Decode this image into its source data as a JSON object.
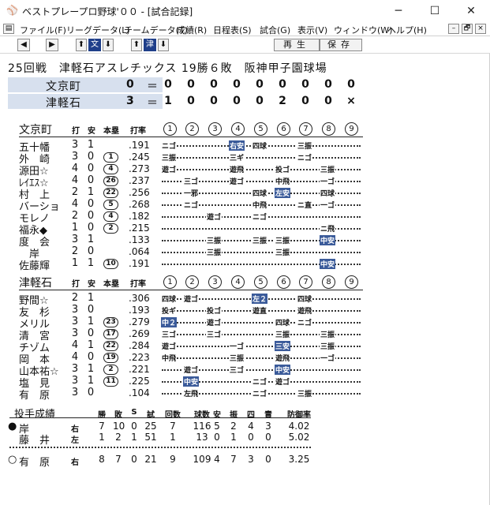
{
  "window": {
    "title": "ベストプレープロ野球'００ - [試合記録]",
    "app_icon": "baseball-cap-icon",
    "controls": [
      "─",
      "☐",
      "✕"
    ]
  },
  "menu": {
    "items": [
      "ファイル(F)",
      "リーグデータ(L)",
      "チームデータ(T)",
      "成績(R)",
      "日程表(S)",
      "試合(G)",
      "表示(V)",
      "ウィンドウ(W)",
      "ヘルプ(H)"
    ],
    "mdi_controls": [
      "–",
      "🗗",
      "×"
    ]
  },
  "toolbar": {
    "prev": "◀",
    "next": "▶",
    "home_up": "⬆",
    "home_label": "文",
    "home_down": "⬇",
    "away_up": "⬆",
    "away_label": "津",
    "away_down": "⬇",
    "replay": "再生",
    "save": "保存"
  },
  "game": {
    "info": "25回戦　津軽石アスレチックス 19勝６敗　阪神甲子園球場"
  },
  "linescore": [
    {
      "team": "文京町",
      "runs": "0",
      "innings": [
        "0",
        "0",
        "0",
        "0",
        "0",
        "0",
        "0",
        "0",
        "0"
      ]
    },
    {
      "team": "津軽石",
      "runs": "3",
      "innings": [
        "1",
        "0",
        "0",
        "0",
        "0",
        "2",
        "0",
        "0",
        "×"
      ]
    }
  ],
  "box_headers": {
    "ab": "打",
    "h": "安",
    "hr": "本塁",
    "avg": "打率",
    "innings": [
      "1",
      "2",
      "3",
      "4",
      "5",
      "6",
      "7",
      "8",
      "9"
    ]
  },
  "teams": [
    {
      "name": "文京町",
      "players": [
        {
          "name": "五十幡",
          "ab": "3",
          "h": "1",
          "hr": "",
          "avg": ".191",
          "results": [
            [
              "1",
              "ニゴ",
              0
            ],
            [
              "4",
              "右安",
              1
            ],
            [
              "5",
              "四球",
              0
            ],
            [
              "7",
              "三振",
              0
            ]
          ]
        },
        {
          "name": "外　崎",
          "ab": "3",
          "h": "0",
          "hr": "1",
          "avg": ".245",
          "results": [
            [
              "1",
              "三振",
              0
            ],
            [
              "4",
              "三ギ",
              0
            ],
            [
              "7",
              "ニゴ",
              0
            ]
          ]
        },
        {
          "name": "源田☆",
          "ab": "4",
          "h": "0",
          "hr": "4",
          "avg": ".273",
          "results": [
            [
              "1",
              "遊ゴ",
              0
            ],
            [
              "4",
              "遊飛",
              0
            ],
            [
              "6",
              "投ゴ",
              0
            ],
            [
              "8",
              "三振",
              0
            ]
          ]
        },
        {
          "name": "ﾚｲｴｽ☆",
          "ab": "4",
          "h": "0",
          "hr": "26",
          "avg": ".237",
          "results": [
            [
              "2",
              "三ゴ",
              0
            ],
            [
              "4",
              "遊ゴ",
              0
            ],
            [
              "6",
              "中飛",
              0
            ],
            [
              "8",
              "一ゴ",
              0
            ]
          ]
        },
        {
          "name": "村　上",
          "ab": "2",
          "h": "1",
          "hr": "22",
          "avg": ".256",
          "results": [
            [
              "2",
              "一邪",
              0
            ],
            [
              "5",
              "四球",
              0
            ],
            [
              "6",
              "左安",
              1
            ],
            [
              "8",
              "四球",
              0
            ]
          ]
        },
        {
          "name": "バーショ",
          "ab": "4",
          "h": "0",
          "hr": "5",
          "avg": ".268",
          "results": [
            [
              "2",
              "ニゴ",
              0
            ],
            [
              "5",
              "中飛",
              0
            ],
            [
              "7",
              "ニ直",
              0
            ],
            [
              "8",
              "一ゴ",
              0
            ]
          ]
        },
        {
          "name": "モレノ",
          "ab": "2",
          "h": "0",
          "hr": "4",
          "avg": ".182",
          "results": [
            [
              "3",
              "遊ゴ",
              0
            ],
            [
              "5",
              "ニゴ",
              0
            ]
          ]
        },
        {
          "name": "福永◆",
          "ab": "1",
          "h": "0",
          "hr": "2",
          "avg": ".215",
          "results": [
            [
              "8",
              "ニ飛",
              0
            ]
          ]
        },
        {
          "name": "度　会",
          "ab": "3",
          "h": "1",
          "hr": "",
          "avg": ".133",
          "results": [
            [
              "3",
              "三振",
              0
            ],
            [
              "5",
              "三振",
              0
            ],
            [
              "6",
              "三振",
              0
            ],
            [
              "8",
              "中安",
              1
            ]
          ]
        },
        {
          "name": "　岸",
          "ab": "2",
          "h": "0",
          "hr": "",
          "avg": ".064",
          "results": [
            [
              "3",
              "三振",
              0
            ],
            [
              "6",
              "三振",
              0
            ]
          ]
        },
        {
          "name": "佐藤輝",
          "ab": "1",
          "h": "1",
          "hr": "10",
          "avg": ".191",
          "results": [
            [
              "8",
              "中安",
              1
            ]
          ]
        }
      ]
    },
    {
      "name": "津軽石",
      "players": [
        {
          "name": "野間☆",
          "ab": "2",
          "h": "1",
          "hr": "",
          "avg": ".306",
          "results": [
            [
              "1",
              "四球",
              0
            ],
            [
              "2",
              "遊ゴ",
              0
            ],
            [
              "5",
              "左２",
              1
            ],
            [
              "7",
              "四球",
              0
            ]
          ]
        },
        {
          "name": "友　杉",
          "ab": "3",
          "h": "0",
          "hr": "",
          "avg": ".193",
          "results": [
            [
              "1",
              "投ギ",
              0
            ],
            [
              "3",
              "投ゴ",
              0
            ],
            [
              "5",
              "遊直",
              0
            ],
            [
              "7",
              "遊飛",
              0
            ]
          ]
        },
        {
          "name": "メリル",
          "ab": "3",
          "h": "1",
          "hr": "23",
          "avg": ".279",
          "results": [
            [
              "1",
              "中２",
              1
            ],
            [
              "3",
              "遊ゴ",
              0
            ],
            [
              "6",
              "四球",
              0
            ],
            [
              "7",
              "ニゴ",
              0
            ]
          ]
        },
        {
          "name": "清　宮",
          "ab": "3",
          "h": "0",
          "hr": "17",
          "avg": ".269",
          "results": [
            [
              "1",
              "三ゴ",
              0
            ],
            [
              "3",
              "三ゴ",
              0
            ],
            [
              "6",
              "三振",
              0
            ],
            [
              "8",
              "三振",
              0
            ]
          ]
        },
        {
          "name": "チゾム",
          "ab": "4",
          "h": "1",
          "hr": "22",
          "avg": ".284",
          "results": [
            [
              "1",
              "遊ゴ",
              0
            ],
            [
              "4",
              "一ゴ",
              0
            ],
            [
              "6",
              "三安",
              1
            ],
            [
              "8",
              "三振",
              0
            ]
          ]
        },
        {
          "name": "岡　本",
          "ab": "4",
          "h": "0",
          "hr": "19",
          "avg": ".223",
          "results": [
            [
              "1",
              "中飛",
              0
            ],
            [
              "4",
              "三振",
              0
            ],
            [
              "6",
              "遊飛",
              0
            ],
            [
              "8",
              "一ゴ",
              0
            ]
          ]
        },
        {
          "name": "山本祐☆",
          "ab": "3",
          "h": "1",
          "hr": "2",
          "avg": ".221",
          "results": [
            [
              "2",
              "遊ゴ",
              0
            ],
            [
              "4",
              "三ゴ",
              0
            ],
            [
              "6",
              "中安",
              1
            ]
          ]
        },
        {
          "name": "塩　見",
          "ab": "3",
          "h": "1",
          "hr": "11",
          "avg": ".225",
          "results": [
            [
              "2",
              "中安",
              1
            ],
            [
              "5",
              "ニゴ",
              0
            ],
            [
              "6",
              "遊ゴ",
              0
            ]
          ]
        },
        {
          "name": "有　原",
          "ab": "3",
          "h": "0",
          "hr": "",
          "avg": ".104",
          "results": [
            [
              "2",
              "左飛",
              0
            ],
            [
              "5",
              "ニゴ",
              0
            ],
            [
              "7",
              "三振",
              0
            ]
          ]
        }
      ]
    }
  ],
  "pitching": {
    "title": "投手成績",
    "headers": [
      "勝",
      "敗",
      "S",
      "試",
      "回数",
      "球数",
      "安",
      "振",
      "四",
      "責",
      "防御率"
    ],
    "rows": [
      {
        "mark": "●",
        "name": "岸",
        "hand": "右",
        "vals": [
          "7",
          "10",
          "0",
          "25",
          "7",
          "116",
          "5",
          "2",
          "4",
          "3",
          "4.02"
        ]
      },
      {
        "mark": "",
        "name": "藤　井",
        "hand": "左",
        "vals": [
          "1",
          "2",
          "1",
          "51",
          "1",
          "13",
          "0",
          "1",
          "0",
          "0",
          "5.02"
        ]
      },
      {
        "mark": "○",
        "name": "有　原",
        "hand": "右",
        "vals": [
          "8",
          "7",
          "0",
          "21",
          "9",
          "109",
          "4",
          "7",
          "3",
          "0",
          "3.25"
        ]
      }
    ]
  }
}
